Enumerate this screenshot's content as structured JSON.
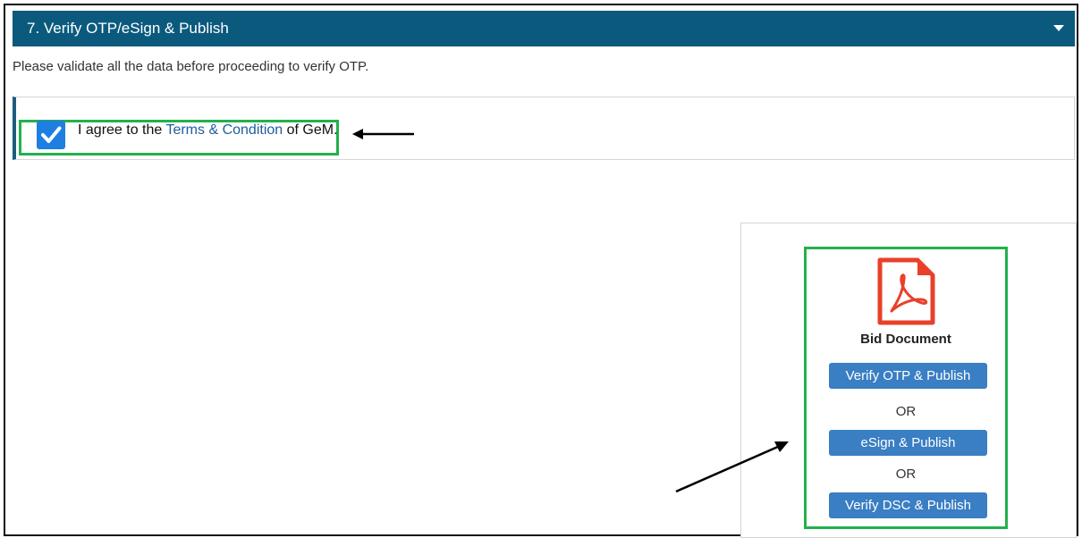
{
  "section": {
    "title": "7. Verify OTP/eSign & Publish"
  },
  "instruction": "Please validate all the data before proceeding to verify OTP.",
  "agreement": {
    "checked": true,
    "text_before": "I agree to the ",
    "link_text": "Terms & Condition",
    "text_after": " of GeM."
  },
  "document": {
    "icon": "pdf-icon",
    "title": "Bid Document",
    "buttons": {
      "verify_otp": "Verify OTP & Publish",
      "esign": "eSign & Publish",
      "verify_dsc": "Verify DSC & Publish"
    },
    "or_separator": "OR"
  },
  "colors": {
    "header_bg": "#0b5a7e",
    "button_bg": "#3a7ec3",
    "checkbox": "#1f7fe0",
    "highlight_green": "#22b14c",
    "pdf_red": "#e8402a"
  }
}
